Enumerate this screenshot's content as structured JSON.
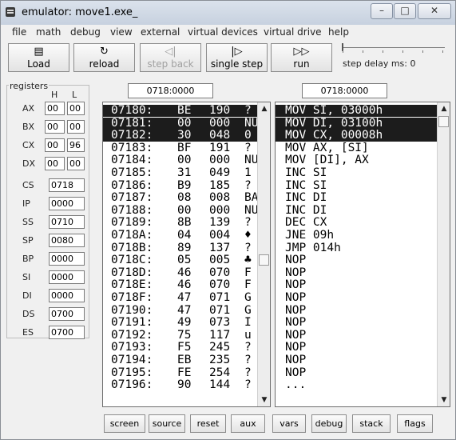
{
  "window": {
    "title": "emulator: move1.exe_"
  },
  "window_controls": {
    "minimize": "–",
    "maximize": "□",
    "close": "✕"
  },
  "menu": [
    "file",
    "math",
    "debug",
    "view",
    "external",
    "virtual devices",
    "virtual drive",
    "help"
  ],
  "toolbar": {
    "load": {
      "icon": "folder-open-icon",
      "glyph": "▤",
      "label": "Load"
    },
    "reload": {
      "icon": "reload-icon",
      "glyph": "↻",
      "label": "reload"
    },
    "step_back": {
      "icon": "step-back-icon",
      "glyph": "◁|",
      "label": "step back"
    },
    "single_step": {
      "icon": "single-step-icon",
      "glyph": "|▷",
      "label": "single step"
    },
    "run": {
      "icon": "run-icon",
      "glyph": "▷▷",
      "label": "run"
    },
    "step_delay": {
      "label": "step delay ms: 0",
      "value": 0
    }
  },
  "registers": {
    "title": "registers",
    "h_label": "H",
    "l_label": "L",
    "pairs": [
      {
        "name": "AX",
        "h": "00",
        "l": "00"
      },
      {
        "name": "BX",
        "h": "00",
        "l": "00"
      },
      {
        "name": "CX",
        "h": "00",
        "l": "96"
      },
      {
        "name": "DX",
        "h": "00",
        "l": "00"
      }
    ],
    "singles": [
      {
        "name": "CS",
        "value": "0718"
      },
      {
        "name": "IP",
        "value": "0000"
      },
      {
        "name": "SS",
        "value": "0710"
      },
      {
        "name": "SP",
        "value": "0080"
      },
      {
        "name": "BP",
        "value": "0000"
      },
      {
        "name": "SI",
        "value": "0000"
      },
      {
        "name": "DI",
        "value": "0000"
      },
      {
        "name": "DS",
        "value": "0700"
      },
      {
        "name": "ES",
        "value": "0700"
      }
    ]
  },
  "memory_address": "0718:0000",
  "disasm_address": "0718:0000",
  "memory_rows": [
    {
      "addr": "07180:",
      "hex": "BE",
      "dec": "190",
      "ch": "?",
      "selected": true
    },
    {
      "addr": "07181:",
      "hex": "00",
      "dec": "000",
      "ch": "NU",
      "selected": true
    },
    {
      "addr": "07182:",
      "hex": "30",
      "dec": "048",
      "ch": "0",
      "selected": true
    },
    {
      "addr": "07183:",
      "hex": "BF",
      "dec": "191",
      "ch": "?",
      "selected": false
    },
    {
      "addr": "07184:",
      "hex": "00",
      "dec": "000",
      "ch": "NU",
      "selected": false
    },
    {
      "addr": "07185:",
      "hex": "31",
      "dec": "049",
      "ch": "1",
      "selected": false
    },
    {
      "addr": "07186:",
      "hex": "B9",
      "dec": "185",
      "ch": "?",
      "selected": false
    },
    {
      "addr": "07187:",
      "hex": "08",
      "dec": "008",
      "ch": "BA",
      "selected": false
    },
    {
      "addr": "07188:",
      "hex": "00",
      "dec": "000",
      "ch": "NU",
      "selected": false
    },
    {
      "addr": "07189:",
      "hex": "8B",
      "dec": "139",
      "ch": "?",
      "selected": false
    },
    {
      "addr": "0718A:",
      "hex": "04",
      "dec": "004",
      "ch": "♦",
      "selected": false
    },
    {
      "addr": "0718B:",
      "hex": "89",
      "dec": "137",
      "ch": "?",
      "selected": false
    },
    {
      "addr": "0718C:",
      "hex": "05",
      "dec": "005",
      "ch": "♣",
      "selected": false
    },
    {
      "addr": "0718D:",
      "hex": "46",
      "dec": "070",
      "ch": "F",
      "selected": false
    },
    {
      "addr": "0718E:",
      "hex": "46",
      "dec": "070",
      "ch": "F",
      "selected": false
    },
    {
      "addr": "0718F:",
      "hex": "47",
      "dec": "071",
      "ch": "G",
      "selected": false
    },
    {
      "addr": "07190:",
      "hex": "47",
      "dec": "071",
      "ch": "G",
      "selected": false
    },
    {
      "addr": "07191:",
      "hex": "49",
      "dec": "073",
      "ch": "I",
      "selected": false
    },
    {
      "addr": "07192:",
      "hex": "75",
      "dec": "117",
      "ch": "u",
      "selected": false
    },
    {
      "addr": "07193:",
      "hex": "F5",
      "dec": "245",
      "ch": "?",
      "selected": false
    },
    {
      "addr": "07194:",
      "hex": "EB",
      "dec": "235",
      "ch": "?",
      "selected": false
    },
    {
      "addr": "07195:",
      "hex": "FE",
      "dec": "254",
      "ch": "?",
      "selected": false
    },
    {
      "addr": "07196:",
      "hex": "90",
      "dec": "144",
      "ch": "?",
      "selected": false
    }
  ],
  "disasm_rows": [
    {
      "text": "MOV SI, 03000h",
      "selected": true
    },
    {
      "text": "MOV DI, 03100h",
      "selected": true
    },
    {
      "text": "MOV CX, 00008h",
      "selected": true
    },
    {
      "text": "MOV AX, [SI]",
      "selected": false
    },
    {
      "text": "MOV [DI], AX",
      "selected": false
    },
    {
      "text": "INC SI",
      "selected": false
    },
    {
      "text": "INC SI",
      "selected": false
    },
    {
      "text": "INC DI",
      "selected": false
    },
    {
      "text": "INC DI",
      "selected": false
    },
    {
      "text": "DEC CX",
      "selected": false
    },
    {
      "text": "JNE 09h",
      "selected": false
    },
    {
      "text": "JMP 014h",
      "selected": false
    },
    {
      "text": "NOP",
      "selected": false
    },
    {
      "text": "NOP",
      "selected": false
    },
    {
      "text": "NOP",
      "selected": false
    },
    {
      "text": "NOP",
      "selected": false
    },
    {
      "text": "NOP",
      "selected": false
    },
    {
      "text": "NOP",
      "selected": false
    },
    {
      "text": "NOP",
      "selected": false
    },
    {
      "text": "NOP",
      "selected": false
    },
    {
      "text": "NOP",
      "selected": false
    },
    {
      "text": "NOP",
      "selected": false
    },
    {
      "text": "...",
      "selected": false
    }
  ],
  "bottom_buttons": [
    "screen",
    "source",
    "reset",
    "aux",
    "vars",
    "debug",
    "stack",
    "flags"
  ]
}
